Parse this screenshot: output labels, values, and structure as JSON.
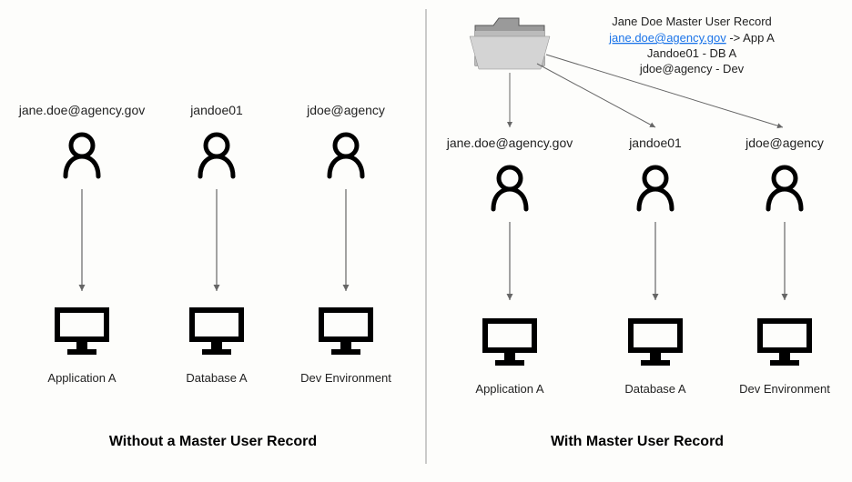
{
  "left": {
    "caption": "Without a Master User Record",
    "columns": [
      {
        "id": "jane.doe@agency.gov",
        "system": "Application A"
      },
      {
        "id": "jandoe01",
        "system": "Database A"
      },
      {
        "id": "jdoe@agency",
        "system": "Dev Environment"
      }
    ]
  },
  "right": {
    "caption": "With Master User Record",
    "record": {
      "title": "Jane Doe Master User Record",
      "mappings": [
        {
          "link": "jane.doe@agency.gov",
          "suffix": " -> App A"
        },
        {
          "text": "Jandoe01 - DB A"
        },
        {
          "text": "jdoe@agency - Dev"
        }
      ]
    },
    "columns": [
      {
        "id": "jane.doe@agency.gov",
        "system": "Application A"
      },
      {
        "id": "jandoe01",
        "system": "Database A"
      },
      {
        "id": "jdoe@agency",
        "system": "Dev Environment"
      }
    ]
  }
}
